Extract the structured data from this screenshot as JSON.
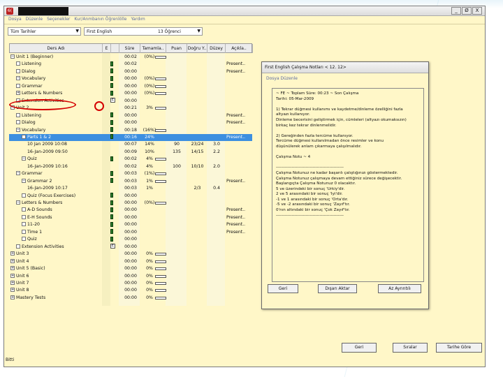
{
  "window": {
    "title_prefix": "6/( ",
    "app_badge": "6(",
    "buttons": {
      "minimize": "_",
      "restore": "Ø",
      "close": "X"
    }
  },
  "menubar": [
    "Dosya",
    "Düzenle",
    "Seçenekler",
    "Kur/Anmbanın Öğrenlölle",
    "Yardım"
  ],
  "filters": {
    "date": "Tüm Tarihler",
    "course": "First English",
    "students": "13 Öğrenci"
  },
  "grid": {
    "columns": [
      "Ders Adı",
      "E",
      "",
      "Süre",
      "Tamamla..",
      "Puan",
      "Doğru Y..",
      "Düzey",
      "Açıkla.."
    ],
    "rows": [
      {
        "tg": "−",
        "name": "Unit 1 (Beginner)",
        "m": "",
        "sure": "00:02",
        "tam": "(0%)",
        "bar": true,
        "puan": "",
        "dogru": "",
        "duzey": "",
        "ack": "",
        "indent": 0
      },
      {
        "tg": "",
        "name": "Listening",
        "m": "g",
        "sure": "00:02",
        "tam": "",
        "bar": false,
        "puan": "",
        "dogru": "",
        "duzey": "",
        "ack": "Present..",
        "indent": 1
      },
      {
        "tg": "",
        "name": "Dialog",
        "m": "g",
        "sure": "00:00",
        "tam": "",
        "bar": false,
        "puan": "",
        "dogru": "",
        "duzey": "",
        "ack": "Present..",
        "indent": 1
      },
      {
        "tg": "−",
        "name": "Vocabulary",
        "m": "g",
        "sure": "00:00",
        "tam": "(0%)",
        "bar": true,
        "puan": "",
        "dogru": "",
        "duzey": "",
        "ack": "",
        "indent": 1
      },
      {
        "tg": "",
        "name": "Grammar",
        "m": "g",
        "sure": "00:00",
        "tam": "(0%)",
        "bar": true,
        "puan": "",
        "dogru": "",
        "duzey": "",
        "ack": "",
        "indent": 1
      },
      {
        "tg": "+",
        "name": "Letters & Numbers",
        "m": "g",
        "sure": "00:00",
        "tam": "(0%)",
        "bar": true,
        "puan": "",
        "dogru": "",
        "duzey": "",
        "ack": "",
        "indent": 1
      },
      {
        "tg": "",
        "name": "Extension Activities",
        "m": "e",
        "sure": "00:00",
        "tam": "",
        "bar": false,
        "puan": "",
        "dogru": "",
        "duzey": "",
        "ack": "",
        "indent": 1
      },
      {
        "tg": "−",
        "name": "Unit 2",
        "m": "",
        "sure": "00:21",
        "tam": "3%",
        "bar": true,
        "puan": "",
        "dogru": "",
        "duzey": "",
        "ack": "",
        "indent": 0
      },
      {
        "tg": "",
        "name": "Listening",
        "m": "g",
        "sure": "00:00",
        "tam": "",
        "bar": false,
        "puan": "",
        "dogru": "",
        "duzey": "",
        "ack": "Present..",
        "indent": 1
      },
      {
        "tg": "",
        "name": "Dialog",
        "m": "g",
        "sure": "00:00",
        "tam": "",
        "bar": false,
        "puan": "",
        "dogru": "",
        "duzey": "",
        "ack": "Present..",
        "indent": 1
      },
      {
        "tg": "−",
        "name": "Vocabulary",
        "m": "g",
        "sure": "00:18",
        "tam": "(16%)",
        "bar": true,
        "puan": "",
        "dogru": "",
        "duzey": "",
        "ack": "",
        "indent": 1
      },
      {
        "tg": "−",
        "name": "Parts 1 & 2",
        "m": "g",
        "sure": "00:16",
        "tam": "24%",
        "bar": false,
        "puan": "",
        "dogru": "",
        "duzey": "",
        "ack": "Present..",
        "indent": 2,
        "selected": true
      },
      {
        "tg": "",
        "name": "10 Jan 2009 10:08",
        "m": "",
        "sure": "00:07",
        "tam": "14%",
        "bar": false,
        "puan": "90",
        "dogru": "23/24",
        "duzey": "3.0",
        "ack": "",
        "indent": 3
      },
      {
        "tg": "",
        "name": "16-Jan-2009 09:50",
        "m": "",
        "sure": "00:09",
        "tam": "10%",
        "bar": false,
        "puan": "135",
        "dogru": "14/15",
        "duzey": "2.2",
        "ack": "",
        "indent": 3
      },
      {
        "tg": "−",
        "name": "Quiz",
        "m": "g",
        "sure": "00:02",
        "tam": "4%",
        "bar": true,
        "puan": "",
        "dogru": "",
        "duzey": "",
        "ack": "",
        "indent": 2
      },
      {
        "tg": "",
        "name": "16-Jan-2009 10:16",
        "m": "",
        "sure": "00:02",
        "tam": "4%",
        "bar": false,
        "puan": "100",
        "dogru": "10/10",
        "duzey": "2.0",
        "ack": "",
        "indent": 3
      },
      {
        "tg": "−",
        "name": "Grammar",
        "m": "g",
        "sure": "00:03",
        "tam": "(1%)",
        "bar": true,
        "puan": "",
        "dogru": "",
        "duzey": "",
        "ack": "",
        "indent": 1
      },
      {
        "tg": "−",
        "name": "Grammar 2",
        "m": "g",
        "sure": "00:03",
        "tam": "1%",
        "bar": true,
        "puan": "",
        "dogru": "",
        "duzey": "",
        "ack": "Present..",
        "indent": 2
      },
      {
        "tg": "",
        "name": "16-Jan-2009 10:17",
        "m": "",
        "sure": "00:03",
        "tam": "1%",
        "bar": false,
        "puan": "",
        "dogru": "2/3",
        "duzey": "0.4",
        "ack": "",
        "indent": 3
      },
      {
        "tg": "",
        "name": "Quiz (Focus Exercises)",
        "m": "g",
        "sure": "00:00",
        "tam": "",
        "bar": false,
        "puan": "",
        "dogru": "",
        "duzey": "",
        "ack": "",
        "indent": 2
      },
      {
        "tg": "−",
        "name": "Letters & Numbers",
        "m": "g",
        "sure": "00:00",
        "tam": "(0%)",
        "bar": true,
        "puan": "",
        "dogru": "",
        "duzey": "",
        "ack": "",
        "indent": 1
      },
      {
        "tg": "",
        "name": "A-D Sounds",
        "m": "g",
        "sure": "00:00",
        "tam": "",
        "bar": false,
        "puan": "",
        "dogru": "",
        "duzey": "",
        "ack": "Present..",
        "indent": 2
      },
      {
        "tg": "",
        "name": "E-H Sounds",
        "m": "g",
        "sure": "00:00",
        "tam": "",
        "bar": false,
        "puan": "",
        "dogru": "",
        "duzey": "",
        "ack": "Present..",
        "indent": 2
      },
      {
        "tg": "",
        "name": "11-20",
        "m": "g",
        "sure": "00:00",
        "tam": "",
        "bar": false,
        "puan": "",
        "dogru": "",
        "duzey": "",
        "ack": "Present..",
        "indent": 2
      },
      {
        "tg": "",
        "name": "Time 1",
        "m": "g",
        "sure": "00:00",
        "tam": "",
        "bar": false,
        "puan": "",
        "dogru": "",
        "duzey": "",
        "ack": "Present..",
        "indent": 2
      },
      {
        "tg": "",
        "name": "Quiz",
        "m": "g",
        "sure": "00:00",
        "tam": "",
        "bar": false,
        "puan": "",
        "dogru": "",
        "duzey": "",
        "ack": "",
        "indent": 2
      },
      {
        "tg": "",
        "name": "Extension Activities",
        "m": "e",
        "sure": "00:00",
        "tam": "",
        "bar": false,
        "puan": "",
        "dogru": "",
        "duzey": "",
        "ack": "",
        "indent": 1
      },
      {
        "tg": "+",
        "name": "Unit 3",
        "m": "",
        "sure": "00:00",
        "tam": "0%",
        "bar": true,
        "puan": "",
        "dogru": "",
        "duzey": "",
        "ack": "",
        "indent": 0
      },
      {
        "tg": "+",
        "name": "Unit 4",
        "m": "",
        "sure": "00:00",
        "tam": "0%",
        "bar": true,
        "puan": "",
        "dogru": "",
        "duzey": "",
        "ack": "",
        "indent": 0
      },
      {
        "tg": "+",
        "name": "Unit 5 (Basic)",
        "m": "",
        "sure": "00:00",
        "tam": "0%",
        "bar": true,
        "puan": "",
        "dogru": "",
        "duzey": "",
        "ack": "",
        "indent": 0
      },
      {
        "tg": "+",
        "name": "Unit 6",
        "m": "",
        "sure": "00:00",
        "tam": "0%",
        "bar": true,
        "puan": "",
        "dogru": "",
        "duzey": "",
        "ack": "",
        "indent": 0
      },
      {
        "tg": "+",
        "name": "Unit 7",
        "m": "",
        "sure": "00:00",
        "tam": "0%",
        "bar": true,
        "puan": "",
        "dogru": "",
        "duzey": "",
        "ack": "",
        "indent": 0
      },
      {
        "tg": "+",
        "name": "Unit 8",
        "m": "",
        "sure": "00:00",
        "tam": "0%",
        "bar": true,
        "puan": "",
        "dogru": "",
        "duzey": "",
        "ack": "",
        "indent": 0
      },
      {
        "tg": "+",
        "name": "Mastery Tests",
        "m": "",
        "sure": "00:00",
        "tam": "0%",
        "bar": true,
        "puan": "",
        "dogru": "",
        "duzey": "",
        "ack": "",
        "indent": 0
      }
    ]
  },
  "dialog": {
    "title": "First English        Çalışma Notları < 12. 12>",
    "menu": "Dosya    Düzenle",
    "lines": [
      "                         ~ FE  ~ Toplam Süre: 00:23  ~ Son Çalışma",
      "Tarihi: 05-Mar-2009",
      "",
      "1) Tekrar düğmesi kullanımı ve kaydetme/dinleme özelliğini fazla",
      "altyazı kullanıyor.",
      "Dinleme becerisini geliştirmek için, cümleleri (altyazı okumaksızın)",
      "birkaç kez tekrar dinlenmelidir.",
      "",
      "2) Gereğinden fazla tercüme kullanıyor.",
      "Tercüme düğmesi kullanılmadan önce resimler ve konu",
      "düşünülerek anlam çıkarmaya çalışılmalıdır.",
      "",
      "Çalışma Notu ~  4",
      "",
      "------------------------------------------------",
      "Çalışma Notunuz ne kadar başarılı çalıştığınızı göstermektedir.",
      "Çalışma Notunuz çalışmaya devam ettiğiniz sürece değişecektir.",
      "Başlangıçta Çalışma Notunuz 0 olacaktır.",
      "  5 ve üzerindeki bir sonuç 'Ürkiy'dir.",
      "  2 ve 5 arasındaki bir sonuç 'İyi'dir.",
      "  -1 ve 1 arasındaki bir sonuç 'Orta'dır.",
      "  -5 ve -2 arasındaki bir sonuç 'Zayıf'tır.",
      "  0'nın altındaki bir sonuç 'Çok Zayıf'tır.",
      "------------------------------------------------"
    ],
    "buttons": {
      "back": "Geri",
      "export": "Dışarı Aktar",
      "less": "Az Ayrıntılı"
    }
  },
  "footer": {
    "back": "Geri",
    "timeline": "Sıralar",
    "date_filter": "Tarihe Göre",
    "status": "Bitti"
  },
  "colors": {
    "panel_bg": "#fff7c8",
    "selection": "#3d8fe0",
    "highlight_oval": "#d40000"
  }
}
